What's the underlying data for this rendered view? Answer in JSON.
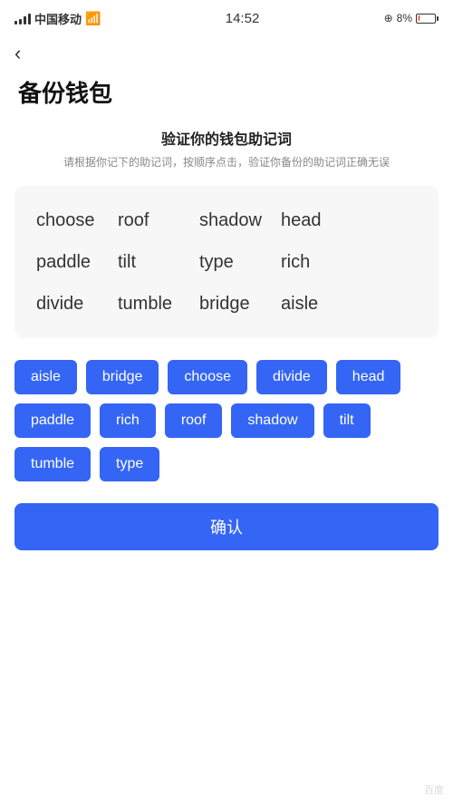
{
  "statusBar": {
    "carrier": "中国移动",
    "time": "14:52",
    "batteryPercent": "8%",
    "signalLabel": "signal"
  },
  "backButton": {
    "label": "‹"
  },
  "pageTitle": "备份钱包",
  "sectionTitle": "验证你的钱包助记词",
  "sectionSubtitle": "请根据你记下的助记词，按顺序点击，验证你备份的助记词正确无误",
  "displayWords": [
    "choose",
    "roof",
    "shadow",
    "head",
    "paddle",
    "tilt",
    "type",
    "rich",
    "divide",
    "tumble",
    "bridge",
    "aisle"
  ],
  "chips": [
    "aisle",
    "bridge",
    "choose",
    "divide",
    "head",
    "paddle",
    "rich",
    "roof",
    "shadow",
    "tilt",
    "tumble",
    "type"
  ],
  "confirmButton": "确认",
  "watermark": "Baidu"
}
